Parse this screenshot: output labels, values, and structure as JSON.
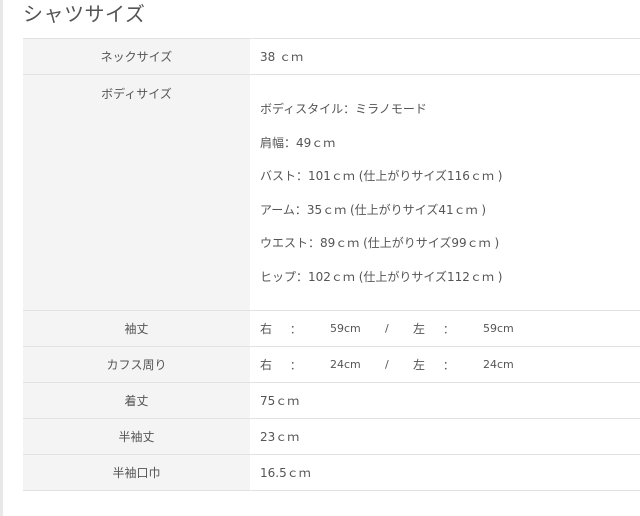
{
  "page_title": "シャツサイズ",
  "rows": {
    "neck": {
      "label": "ネックサイズ",
      "value": "38 ｃｍ"
    },
    "body": {
      "label": "ボディサイズ",
      "lines": [
        "ボディスタイル：ミラノモード",
        "肩幅：49ｃｍ",
        "バスト：101ｃｍ (仕上がりサイズ116ｃｍ )",
        "アーム：35ｃｍ (仕上がりサイズ41ｃｍ )",
        "ウエスト：89ｃｍ (仕上がりサイズ99ｃｍ )",
        "ヒップ：102ｃｍ (仕上がりサイズ112ｃｍ )"
      ]
    },
    "sleeve": {
      "label": "袖丈",
      "right_label": "右",
      "colon": "：",
      "right_value": "59cm",
      "slash": "/",
      "left_label": "左",
      "left_value": "59cm"
    },
    "cuff": {
      "label": "カフス周り",
      "right_label": "右",
      "colon": "：",
      "right_value": "24cm",
      "slash": "/",
      "left_label": "左",
      "left_value": "24cm"
    },
    "length": {
      "label": "着丈",
      "value": "75ｃｍ"
    },
    "half_sleeve": {
      "label": "半袖丈",
      "value": "23ｃｍ"
    },
    "half_sleeve_width": {
      "label": "半袖口巾",
      "value": "16.5ｃｍ"
    }
  }
}
